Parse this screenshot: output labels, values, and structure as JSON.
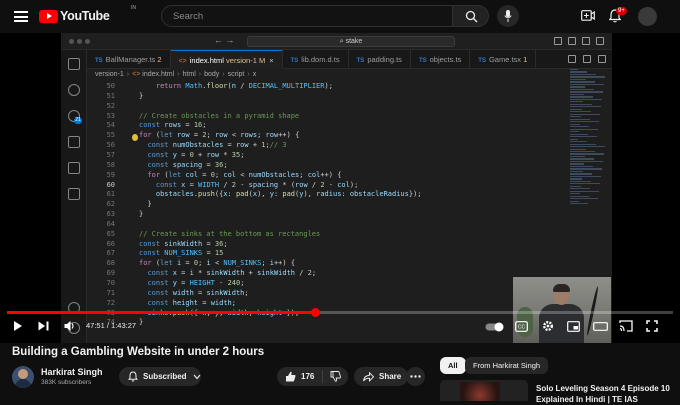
{
  "header": {
    "logo_text": "YouTube",
    "country_code": "IN",
    "search_placeholder": "Search",
    "notification_count": "9+",
    "icons": [
      "menu-icon",
      "search-icon",
      "mic-icon",
      "create-icon",
      "notifications-icon",
      "avatar"
    ]
  },
  "editor": {
    "command_center": "stake",
    "tabs": [
      {
        "label": "BallManager.ts",
        "badge": "2",
        "type": "TS",
        "active": false
      },
      {
        "label": "index.html",
        "badge": "version-1 M",
        "type": "HTML",
        "active": true
      },
      {
        "label": "lib.dom.d.ts",
        "badge": "",
        "type": "TS",
        "active": false
      },
      {
        "label": "padding.ts",
        "badge": "",
        "type": "TS",
        "active": false
      },
      {
        "label": "objects.ts",
        "badge": "",
        "type": "TS",
        "active": false
      },
      {
        "label": "Game.tsx",
        "badge": "1",
        "type": "TS",
        "active": false
      }
    ],
    "breadcrumbs": [
      "version-1",
      "index.html",
      "html",
      "body",
      "script",
      "x"
    ],
    "source_control_badge": "21",
    "current_line": "60",
    "lines": [
      {
        "n": "50",
        "text": "    return Math.floor(n / DECIMAL_MULTIPLIER);"
      },
      {
        "n": "51",
        "text": "}"
      },
      {
        "n": "52",
        "text": ""
      },
      {
        "n": "53",
        "text": "// Create obstacles in a pyramid shape"
      },
      {
        "n": "54",
        "text": "const rows = 16;"
      },
      {
        "n": "55",
        "text": "for (let row = 2; row < rows; row++) {"
      },
      {
        "n": "56",
        "text": "  const numObstacles = row + 1;// 3"
      },
      {
        "n": "57",
        "text": "  const y = 0 + row * 35;"
      },
      {
        "n": "58",
        "text": "  const spacing = 36;"
      },
      {
        "n": "59",
        "text": "  for (let col = 0; col < numObstacles; col++) {"
      },
      {
        "n": "60",
        "text": "    const x = WIDTH / 2 - spacing * (row / 2 - col);"
      },
      {
        "n": "61",
        "text": "    obstacles.push({x: pad(x), y: pad(y), radius: obstacleRadius});"
      },
      {
        "n": "62",
        "text": "  }"
      },
      {
        "n": "63",
        "text": "}"
      },
      {
        "n": "64",
        "text": ""
      },
      {
        "n": "65",
        "text": "// Create sinks at the bottom as rectangles"
      },
      {
        "n": "66",
        "text": "const sinkWidth = 36;"
      },
      {
        "n": "67",
        "text": "const NUM_SINKS = 15"
      },
      {
        "n": "68",
        "text": "for (let i = 0; i < NUM_SINKS; i++) {"
      },
      {
        "n": "69",
        "text": "  const x = i * sinkWidth + sinkWidth / 2;"
      },
      {
        "n": "70",
        "text": "  const y = HEIGHT - 240;"
      },
      {
        "n": "71",
        "text": "  const width = sinkWidth;"
      },
      {
        "n": "72",
        "text": "  const height = width;"
      },
      {
        "n": "73",
        "text": "  sinks.push({ x, y, width, height });"
      },
      {
        "n": "74",
        "text": "}"
      }
    ]
  },
  "player": {
    "time_current": "47:51",
    "time_total": "1:43:27",
    "time_display": "47:51 / 1:43:27",
    "progress_fraction": 0.463,
    "accent": "#ff0000"
  },
  "video": {
    "title": "Building a Gambling Website in under 2 hours",
    "channel_name": "Harkirat Singh",
    "subscribers": "383K subscribers",
    "subscribe_label": "Subscribed",
    "likes": "176",
    "share_label": "Share"
  },
  "recommendations": {
    "chips": [
      "All",
      "From Harkirat Singh"
    ],
    "first_title": "Solo Leveling Season 4 Episode 10 Explained In Hindi | TE IAS"
  }
}
